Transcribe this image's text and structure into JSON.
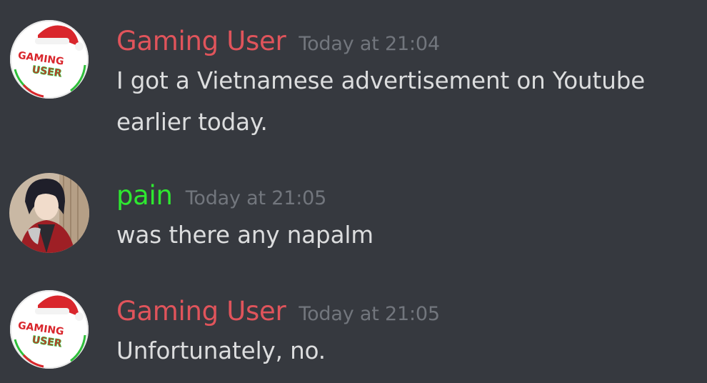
{
  "messages": [
    {
      "author": "Gaming User",
      "author_color": "#e0545b",
      "timestamp": "Today at 21:04",
      "avatar": "gaming-user-avatar",
      "avatar_text": [
        "GAMING",
        "USER"
      ],
      "lines": [
        "I got a Vietnamese advertisement on Youtube",
        "earlier today."
      ]
    },
    {
      "author": "pain",
      "author_color": "#2ee830",
      "timestamp": "Today at 21:05",
      "avatar": "anime-character-avatar",
      "lines": [
        "was there any napalm"
      ]
    },
    {
      "author": "Gaming User",
      "author_color": "#e0545b",
      "timestamp": "Today at 21:05",
      "avatar": "gaming-user-avatar",
      "avatar_text": [
        "GAMING",
        "USER"
      ],
      "lines": [
        "Unfortunately, no."
      ]
    }
  ],
  "colors": {
    "background": "#36393f",
    "message_text": "#dcddde",
    "timestamp": "#72767d"
  }
}
